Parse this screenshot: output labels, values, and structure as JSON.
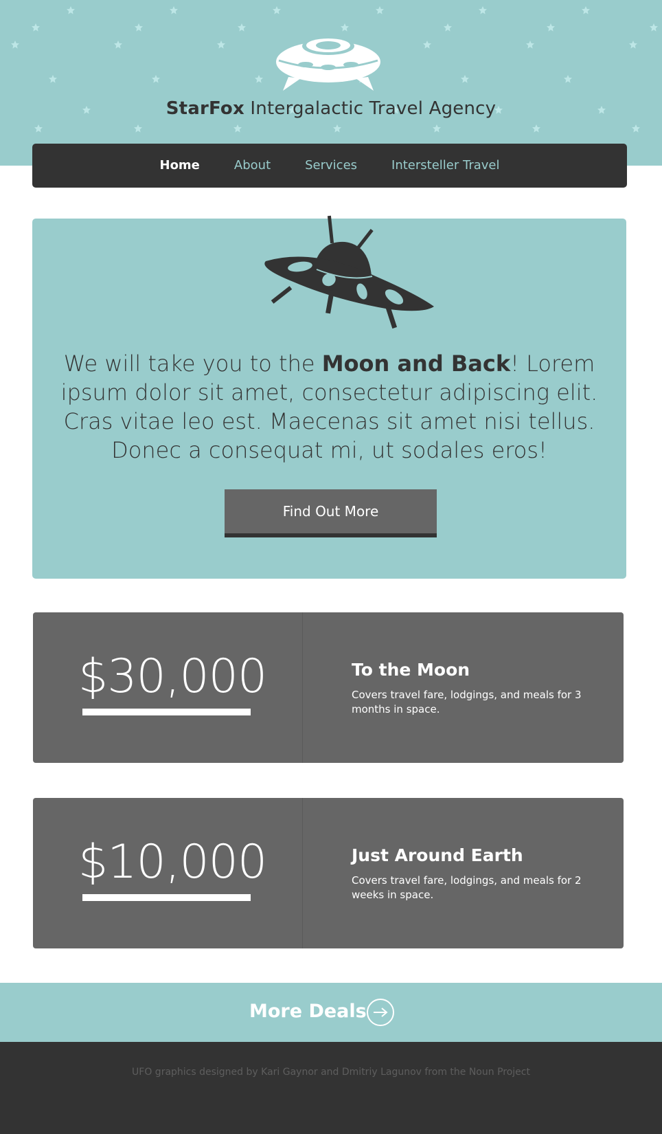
{
  "header": {
    "brand": "StarFox",
    "tagline": " Intergalactic Travel Agency"
  },
  "nav": {
    "items": [
      {
        "label": "Home",
        "active": true
      },
      {
        "label": "About",
        "active": false
      },
      {
        "label": "Services",
        "active": false
      },
      {
        "label": "Intersteller Travel",
        "active": false
      }
    ]
  },
  "hero": {
    "text_before": "We will take you to the ",
    "text_bold": "Moon and Back",
    "text_after": "!  Lorem ipsum dolor sit amet, consectetur adipiscing elit. Cras vitae leo est. Maecenas sit amet nisi tellus. Donec a consequat mi, ut sodales eros!",
    "button_label": "Find Out More"
  },
  "deals": [
    {
      "price": "$30,000",
      "title": "To the Moon",
      "description": "Covers travel fare, lodgings, and meals for 3 months in space."
    },
    {
      "price": "$10,000",
      "title": "Just Around Earth",
      "description": "Covers travel fare, lodgings, and meals for 2 weeks in space."
    }
  ],
  "more_deals": {
    "label": "More Deals",
    "icon": "arrow-right-circle-icon"
  },
  "footer": {
    "credit": "UFO graphics designed by Kari Gaynor and Dmitriy Lagunov from the Noun Project"
  },
  "colors": {
    "teal": "#99cccc",
    "dark": "#333333",
    "gray": "#666666",
    "white": "#ffffff",
    "star": "#bde6e6"
  }
}
